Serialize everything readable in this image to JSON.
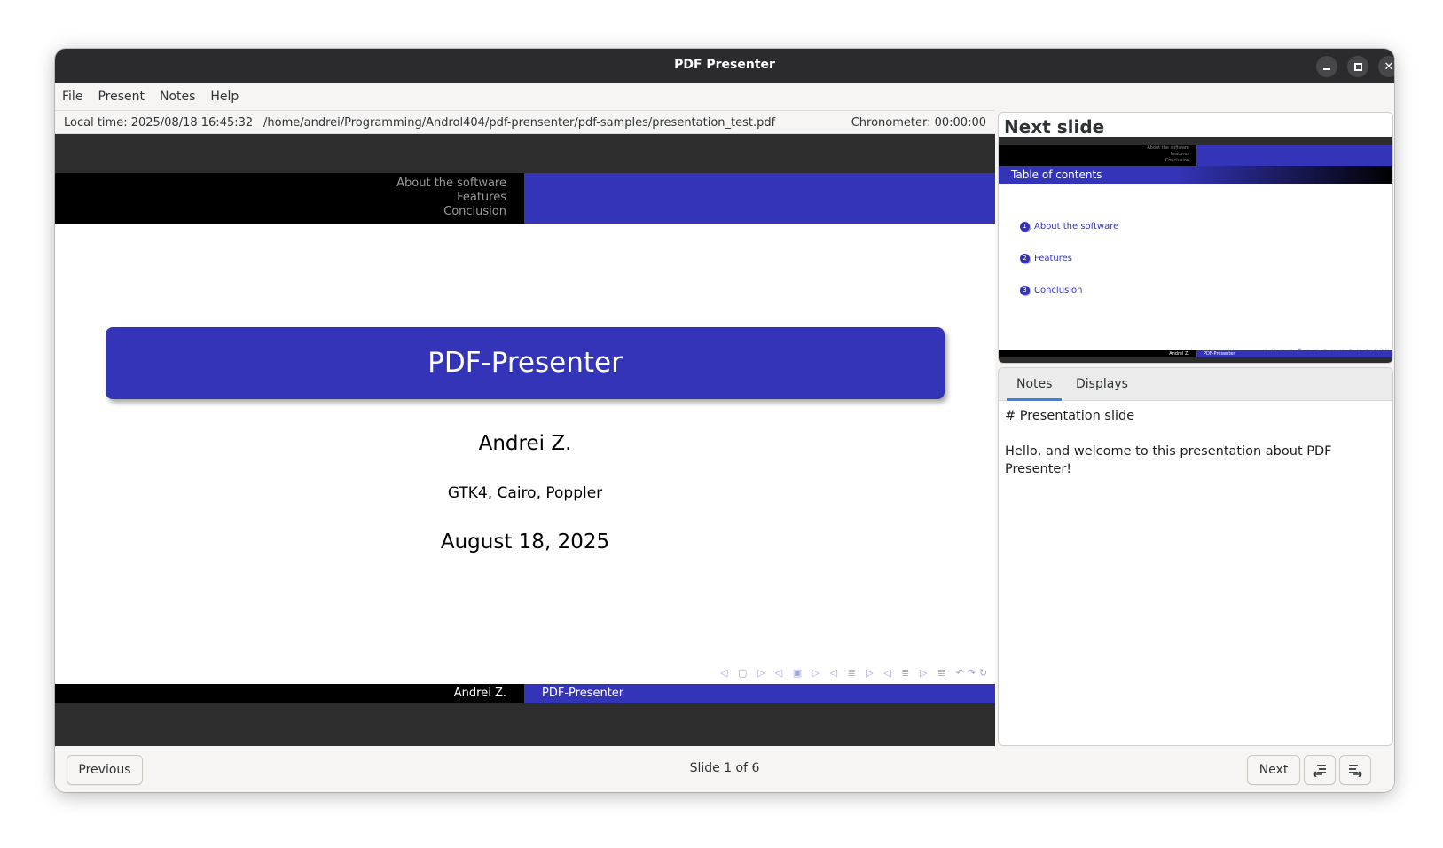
{
  "window": {
    "title": "PDF Presenter"
  },
  "menu": [
    "File",
    "Present",
    "Notes",
    "Help"
  ],
  "info": {
    "local_time": "Local time: 2025/08/18 16:45:32",
    "path": "/home/andrei/Programming/Androl404/pdf-prensenter/pdf-samples/presentation_test.pdf",
    "chronometer": "Chronometer: 00:00:00"
  },
  "current_slide": {
    "sections": [
      "About the software",
      "Features",
      "Conclusion"
    ],
    "title": "PDF-Presenter",
    "author": "Andrei Z.",
    "subtitle": "GTK4, Cairo, Poppler",
    "date": "August 18, 2025",
    "footer_left": "Andrei Z.",
    "footer_right": "PDF-Presenter",
    "nav_symbols": "◁ ▢ ▷ ◁ ▣ ▷ ◁ ≣ ▷ ◁ ≣ ▷ ≣ ↶↷↻"
  },
  "next_slide": {
    "heading": "Next slide",
    "sections": [
      "About the software",
      "Features",
      "Conclusion"
    ],
    "bar_title": "Table of contents",
    "items": [
      {
        "num": "1",
        "label": "About the software"
      },
      {
        "num": "2",
        "label": "Features"
      },
      {
        "num": "3",
        "label": "Conclusion"
      }
    ],
    "footer_left": "Andrei Z.",
    "footer_right": "PDF-Presenter"
  },
  "notes_panel": {
    "tabs": [
      "Notes",
      "Displays"
    ],
    "active_tab": "Notes",
    "text": "# Presentation slide\n\nHello, and welcome to this presentation about PDF Presenter!"
  },
  "controls": {
    "previous_label": "Previous",
    "next_label": "Next",
    "slide_counter": "Slide 1 of 6"
  },
  "progress": {
    "fraction": 0.1667,
    "color": "#2ec27e"
  },
  "colors": {
    "beamer_blue": "#3434b8",
    "titlebar": "#2b2b2e"
  }
}
